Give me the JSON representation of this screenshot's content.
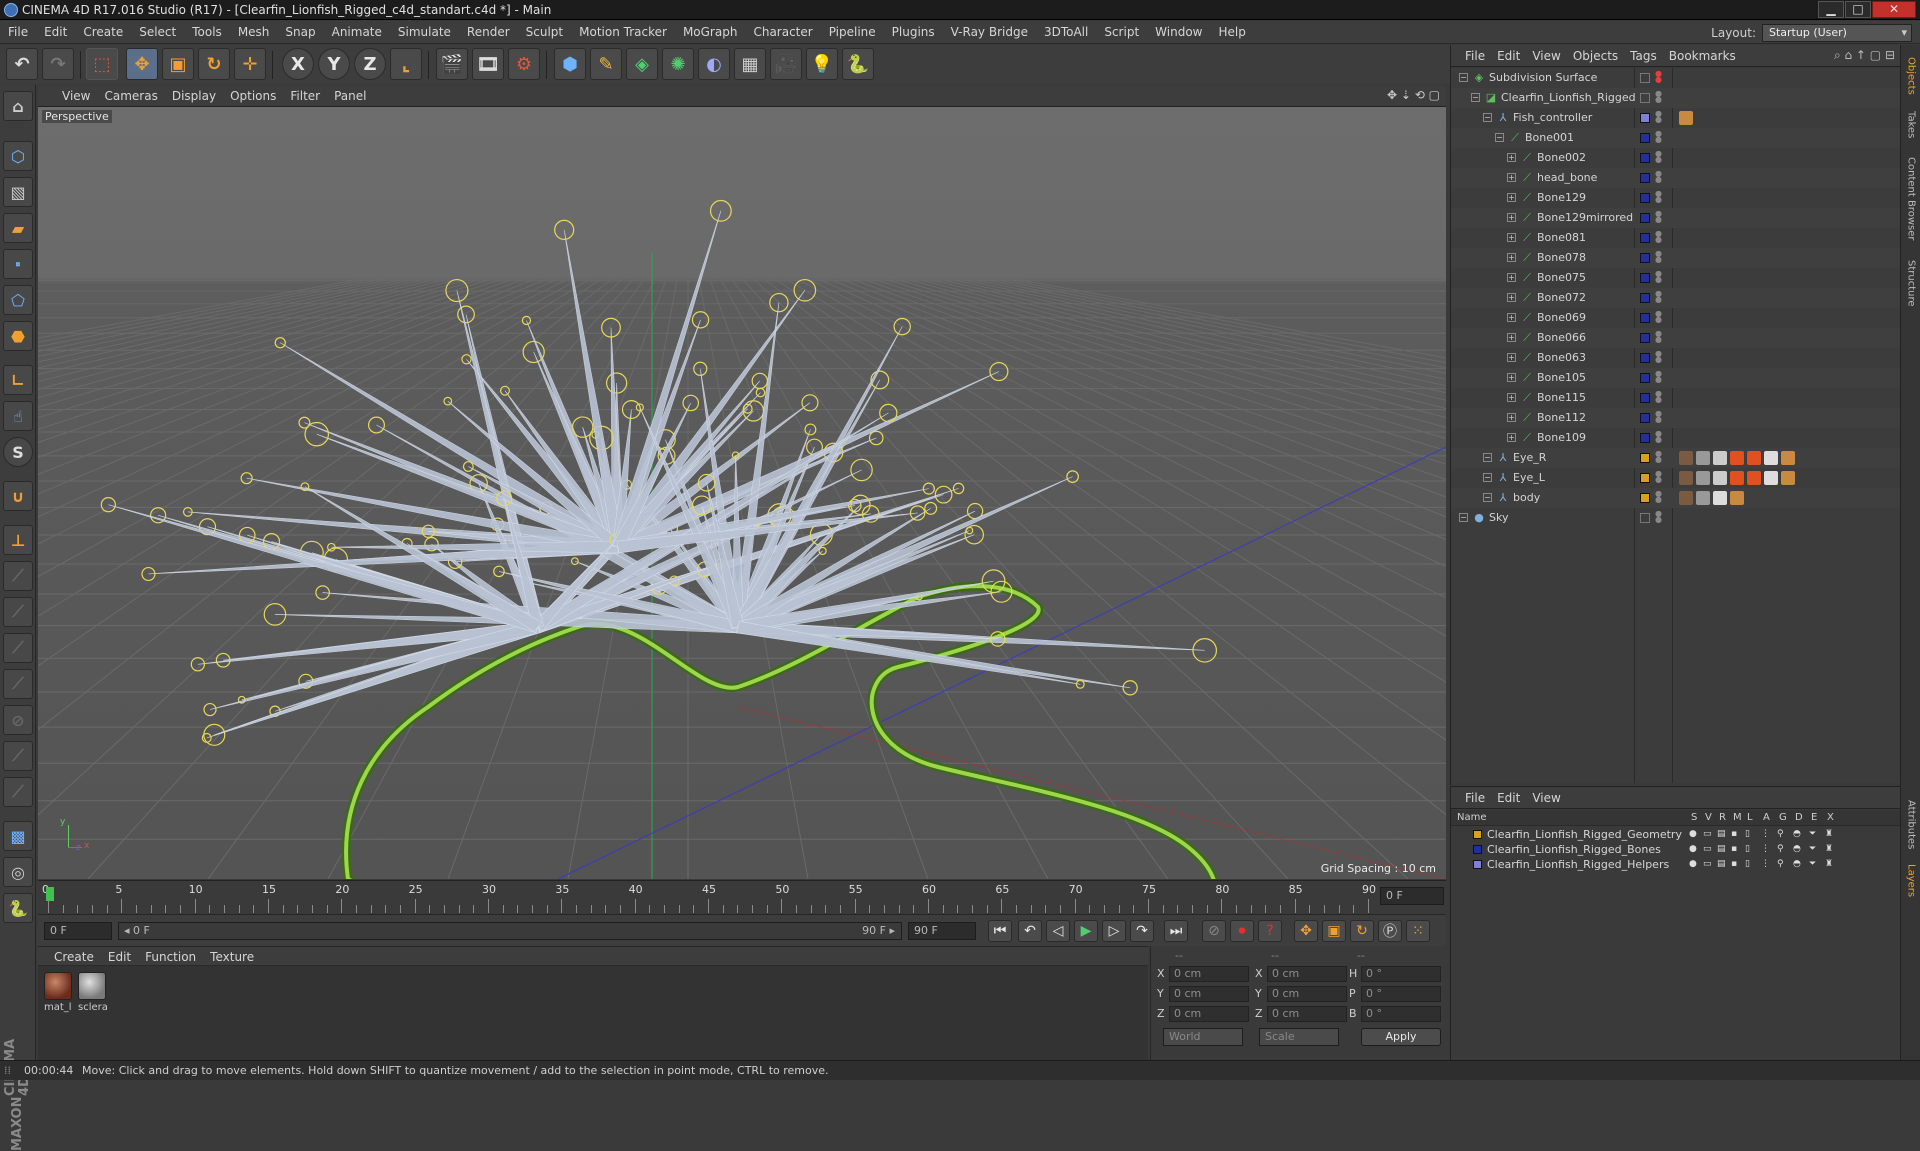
{
  "window": {
    "title": "CINEMA 4D R17.016 Studio (R17) - [Clearfin_Lionfish_Rigged_c4d_standart.c4d *] - Main",
    "minimize": "▁",
    "maximize": "□",
    "close": "✕"
  },
  "menu": [
    "File",
    "Edit",
    "Create",
    "Select",
    "Tools",
    "Mesh",
    "Snap",
    "Animate",
    "Simulate",
    "Render",
    "Sculpt",
    "Motion Tracker",
    "MoGraph",
    "Character",
    "Pipeline",
    "Plugins",
    "V-Ray Bridge",
    "3DToAll",
    "Script",
    "Window",
    "Help"
  ],
  "layout": {
    "label": "Layout:",
    "value": "Startup (User)"
  },
  "toolbar": {
    "x_label": "X",
    "y_label": "Y",
    "z_label": "Z"
  },
  "left_toolbar": {
    "s_label": "S"
  },
  "brand": {
    "line1": "MAXON",
    "line2": "CINEMA 4D"
  },
  "viewport": {
    "menu": [
      "View",
      "Cameras",
      "Display",
      "Options",
      "Filter",
      "Panel"
    ],
    "label": "Perspective",
    "grid_spacing": "Grid Spacing : 10 cm",
    "axis_y": "y",
    "axis_x": "x",
    "axis_z": "z"
  },
  "timeline": {
    "ticks": [
      "0",
      "5",
      "10",
      "15",
      "20",
      "25",
      "30",
      "35",
      "40",
      "45",
      "50",
      "55",
      "60",
      "65",
      "70",
      "75",
      "80",
      "85",
      "90"
    ],
    "current_frame": "0 F"
  },
  "transport": {
    "start_field": "0 F",
    "range_start": "◂ 0 F",
    "range_end": "90 F ▸",
    "end_field": "90 F"
  },
  "material_manager": {
    "menu": [
      "Create",
      "Edit",
      "Function",
      "Texture"
    ],
    "materials": [
      {
        "label": "mat_l",
        "color": "#7a3c2c"
      },
      {
        "label": "sclera",
        "color": "#9a9a9a"
      }
    ]
  },
  "coordinates": {
    "header": [
      "--",
      "--",
      "--"
    ],
    "rows": [
      {
        "l1": "X",
        "v1": "0 cm",
        "l2": "X",
        "v2": "0 cm",
        "l3": "H",
        "v3": "0 °"
      },
      {
        "l1": "Y",
        "v1": "0 cm",
        "l2": "Y",
        "v2": "0 cm",
        "l3": "P",
        "v3": "0 °"
      },
      {
        "l1": "Z",
        "v1": "0 cm",
        "l2": "Z",
        "v2": "0 cm",
        "l3": "B",
        "v3": "0 °"
      }
    ],
    "coord_system": "World",
    "mode": "Scale",
    "apply": "Apply"
  },
  "status": {
    "time": "00:00:44",
    "message": "Move: Click and drag to move elements. Hold down SHIFT to quantize movement / add to the selection in point mode, CTRL to remove."
  },
  "object_manager": {
    "menu": [
      "File",
      "Edit",
      "View",
      "Objects",
      "Tags",
      "Bookmarks"
    ],
    "objects": [
      {
        "name": "Subdivision Surface",
        "level": 0,
        "icon": "subdivision-icon",
        "layer": "",
        "color": "#5fbf5f"
      },
      {
        "name": "Clearfin_Lionfish_Rigged",
        "level": 1,
        "icon": "polygon-icon",
        "layer": "",
        "color": "#5fbf5f"
      },
      {
        "name": "Fish_controller",
        "level": 2,
        "icon": "null-icon",
        "layer": "#7f7fd8",
        "color": "#7fb0e0"
      },
      {
        "name": "Bone001",
        "level": 3,
        "icon": "bone-icon",
        "layer": "#2030a0",
        "color": "#5fbf5f"
      },
      {
        "name": "Bone002",
        "level": 4,
        "icon": "bone-icon",
        "layer": "#2030a0",
        "color": "#5fbf5f"
      },
      {
        "name": "head_bone",
        "level": 4,
        "icon": "bone-icon",
        "layer": "#2030a0",
        "color": "#5fbf5f"
      },
      {
        "name": "Bone129",
        "level": 4,
        "icon": "bone-icon",
        "layer": "#2030a0",
        "color": "#5fbf5f"
      },
      {
        "name": "Bone129mirrored",
        "level": 4,
        "icon": "bone-icon",
        "layer": "#2030a0",
        "color": "#5fbf5f"
      },
      {
        "name": "Bone081",
        "level": 4,
        "icon": "bone-icon",
        "layer": "#2030a0",
        "color": "#5fbf5f"
      },
      {
        "name": "Bone078",
        "level": 4,
        "icon": "bone-icon",
        "layer": "#2030a0",
        "color": "#5fbf5f"
      },
      {
        "name": "Bone075",
        "level": 4,
        "icon": "bone-icon",
        "layer": "#2030a0",
        "color": "#5fbf5f"
      },
      {
        "name": "Bone072",
        "level": 4,
        "icon": "bone-icon",
        "layer": "#2030a0",
        "color": "#5fbf5f"
      },
      {
        "name": "Bone069",
        "level": 4,
        "icon": "bone-icon",
        "layer": "#2030a0",
        "color": "#5fbf5f"
      },
      {
        "name": "Bone066",
        "level": 4,
        "icon": "bone-icon",
        "layer": "#2030a0",
        "color": "#5fbf5f"
      },
      {
        "name": "Bone063",
        "level": 4,
        "icon": "bone-icon",
        "layer": "#2030a0",
        "color": "#5fbf5f"
      },
      {
        "name": "Bone105",
        "level": 4,
        "icon": "bone-icon",
        "layer": "#2030a0",
        "color": "#5fbf5f"
      },
      {
        "name": "Bone115",
        "level": 4,
        "icon": "bone-icon",
        "layer": "#2030a0",
        "color": "#5fbf5f"
      },
      {
        "name": "Bone112",
        "level": 4,
        "icon": "bone-icon",
        "layer": "#2030a0",
        "color": "#5fbf5f"
      },
      {
        "name": "Bone109",
        "level": 4,
        "icon": "bone-icon",
        "layer": "#2030a0",
        "color": "#5fbf5f"
      },
      {
        "name": "Eye_R",
        "level": 2,
        "icon": "null-icon",
        "layer": "#d8a020",
        "color": "#7fb0e0"
      },
      {
        "name": "Eye_L",
        "level": 2,
        "icon": "null-icon",
        "layer": "#d8a020",
        "color": "#7fb0e0"
      },
      {
        "name": "body",
        "level": 2,
        "icon": "null-icon",
        "layer": "#d8a020",
        "color": "#7fb0e0"
      },
      {
        "name": "Sky",
        "level": 0,
        "icon": "sky-icon",
        "layer": "",
        "color": "#7fb0e0"
      }
    ]
  },
  "layer_manager": {
    "menu": [
      "File",
      "Edit",
      "View"
    ],
    "columns": [
      "Name",
      "S",
      "V",
      "R",
      "M",
      "L",
      "A",
      "G",
      "D",
      "E",
      "X"
    ],
    "layers": [
      {
        "name": "Clearfin_Lionfish_Rigged_Geometry",
        "color": "#d8a020"
      },
      {
        "name": "Clearfin_Lionfish_Rigged_Bones",
        "color": "#2030a0"
      },
      {
        "name": "Clearfin_Lionfish_Rigged_Helpers",
        "color": "#7f7fd8"
      }
    ]
  },
  "side_tabs": [
    "Objects",
    "Takes",
    "Content Browser",
    "Structure",
    "Attributes",
    "Layers"
  ]
}
